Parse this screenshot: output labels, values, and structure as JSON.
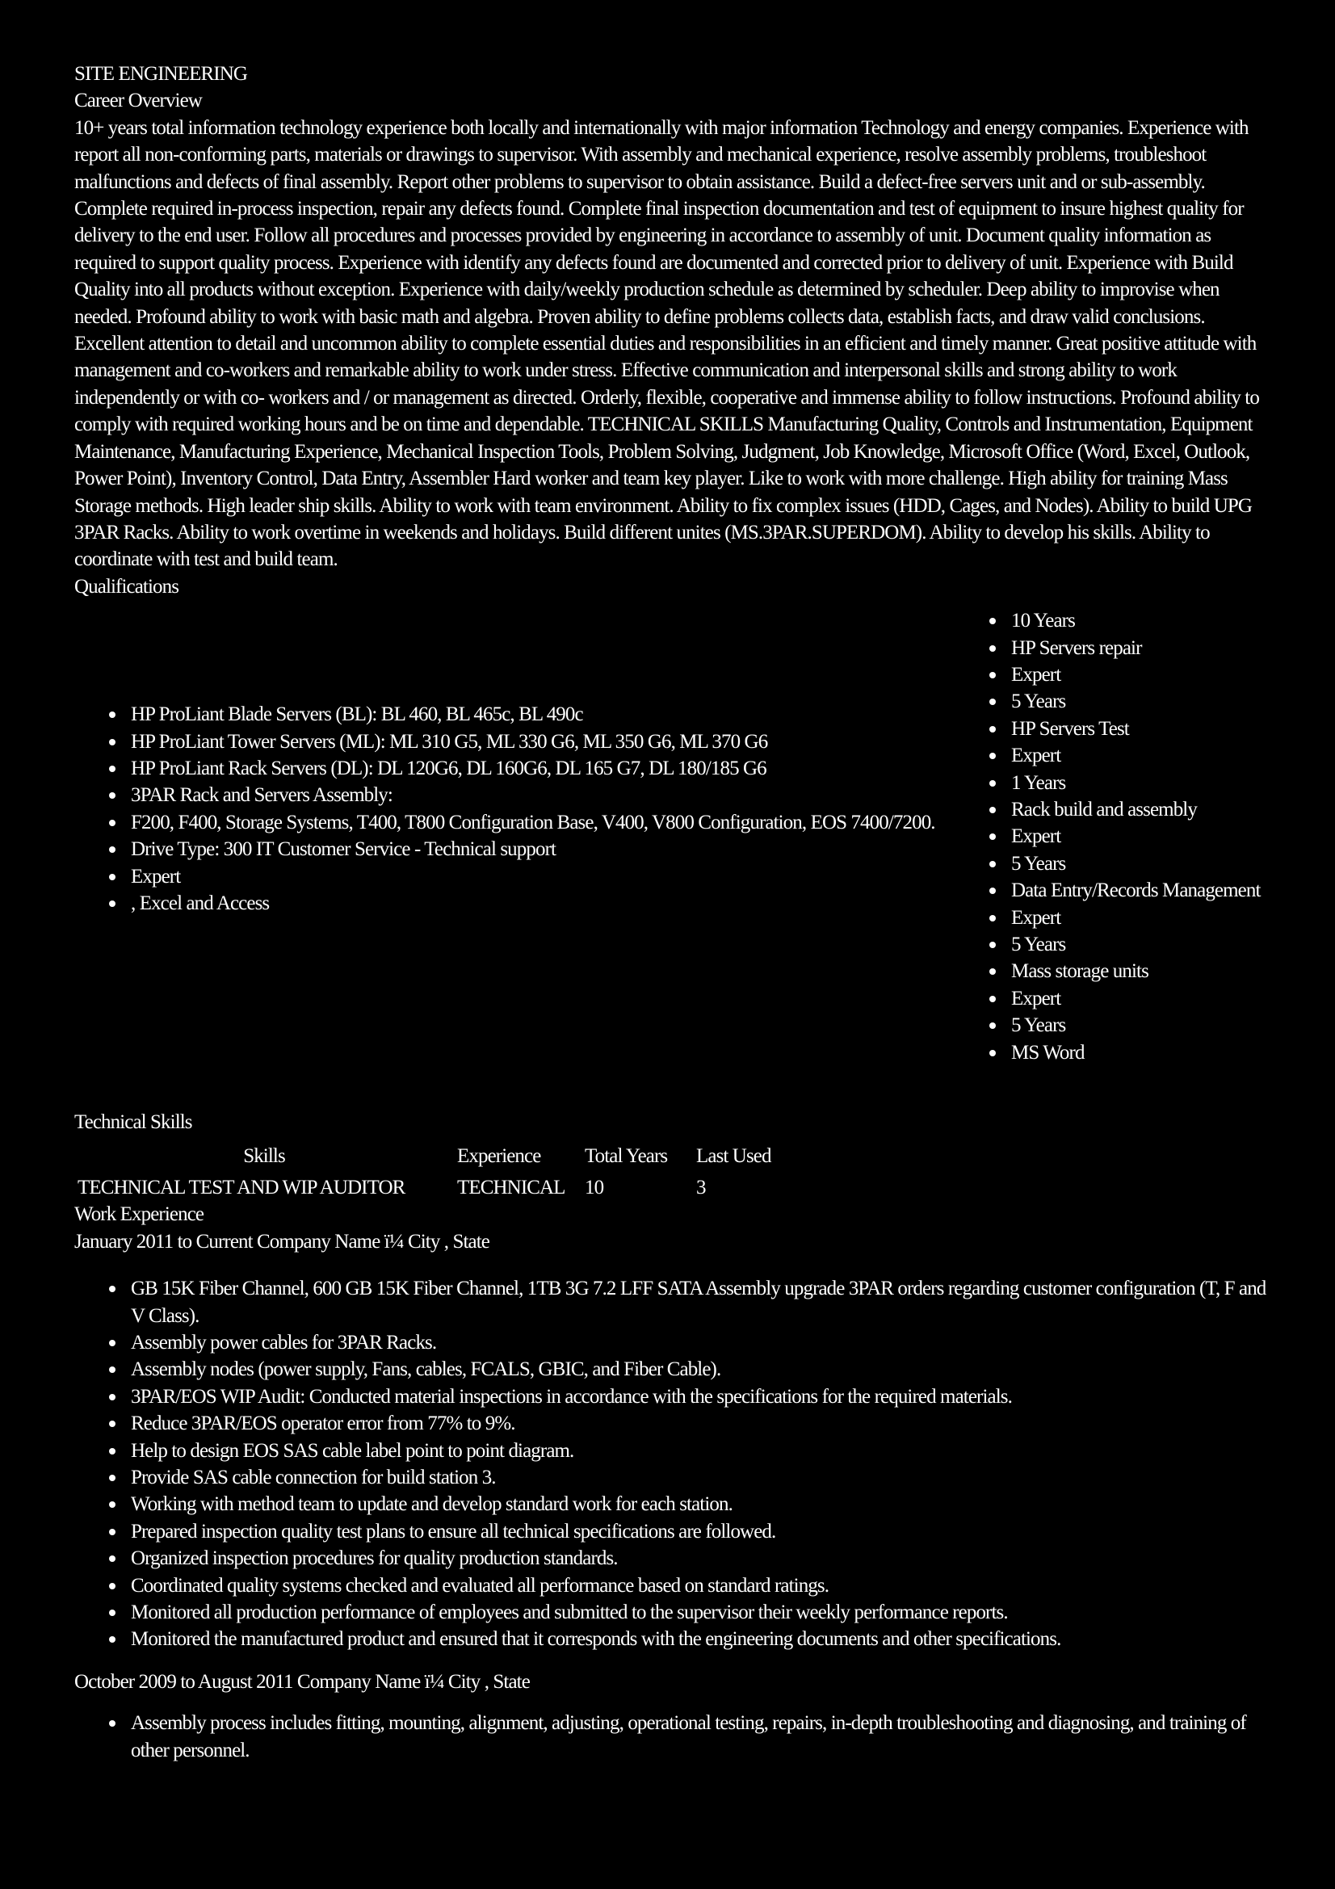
{
  "title": "SITE ENGINEERING",
  "career_overview": {
    "heading": "Career Overview",
    "text": "10+ years total information technology experience both locally and internationally with major information Technology and energy companies. Experience with report all non-conforming parts, materials or drawings to supervisor. With assembly and mechanical experience, resolve assembly problems, troubleshoot malfunctions and defects of final assembly. Report other problems to supervisor to obtain assistance. Build a defect-free servers unit and or sub-assembly. Complete required in-process inspection, repair any defects found. Complete final inspection documentation and test of equipment to insure highest quality for delivery to the end user. Follow all procedures and processes provided by engineering in accordance to assembly of unit. Document quality information as required to support quality process. Experience with identify any defects found are documented and corrected prior to delivery of unit. Experience with Build Quality into all products without exception. Experience with daily/weekly production schedule as determined by scheduler. Deep ability to improvise when needed. Profound ability to work with basic math and algebra. Proven ability to define problems collects data, establish facts, and draw valid conclusions. Excellent attention to detail and uncommon ability to complete essential duties and responsibilities in an efficient and timely manner. Great positive attitude with management and co-workers and remarkable ability to work under stress. Effective communication and interpersonal skills and strong ability to work independently or with co- workers and / or management as directed. Orderly, flexible, cooperative and immense ability to follow instructions. Profound ability to comply with required working hours and be on time and dependable. TECHNICAL SKILLS Manufacturing Quality, Controls and Instrumentation, Equipment Maintenance, Manufacturing Experience, Mechanical Inspection Tools, Problem Solving, Judgment, Job Knowledge, Microsoft Office (Word, Excel, Outlook, Power Point), Inventory Control, Data Entry, Assembler Hard worker and team key player. Like to work with more challenge. High ability for training Mass Storage methods. High leader ship skills. Ability to work with team environment. Ability to fix complex issues (HDD, Cages, and Nodes). Ability to build UPG 3PAR Racks. Ability to work overtime in weekends and holidays. Build different unites (MS.3PAR.SUPERDOM). Ability to develop his skills. Ability to coordinate with test and build team."
  },
  "qualifications": {
    "heading": "Qualifications",
    "left_items": [
      "HP ProLiant Blade Servers (BL): BL 460, BL 465c, BL 490c",
      "HP ProLiant Tower Servers (ML): ML 310 G5, ML 330 G6, ML 350 G6, ML 370 G6",
      "HP ProLiant Rack Servers (DL): DL 120G6, DL 160G6, DL 165 G7, DL 180/185 G6",
      "3PAR Rack and Servers Assembly:",
      "F200, F400, Storage Systems, T400, T800 Configuration Base, V400, V800 Configuration, EOS 7400/7200.",
      "Drive Type: 300 IT Customer Service - Technical support",
      "Expert",
      ", Excel and Access"
    ],
    "right_items": [
      "10 Years",
      "HP Servers repair",
      "Expert",
      "5 Years",
      "HP Servers Test",
      "Expert",
      "1 Years",
      "Rack build and assembly",
      "Expert",
      "5 Years",
      "Data Entry/Records Management",
      "Expert",
      "5 Years",
      "Mass storage units",
      "Expert",
      "5 Years",
      "MS Word"
    ]
  },
  "technical_skills": {
    "heading": "Technical Skills",
    "columns": [
      "Skills",
      "Experience",
      "Total Years",
      "Last Used"
    ],
    "rows": [
      [
        "TECHNICAL TEST AND WIP AUDITOR",
        "TECHNICAL",
        "10",
        "3"
      ]
    ]
  },
  "work_experience": {
    "heading": "Work Experience",
    "jobs": [
      {
        "header": "January 2011 to Current Company Name ï¼ City , State",
        "items": [
          "GB 15K Fiber Channel, 600 GB 15K Fiber Channel, 1TB 3G 7.2 LFF SATA Assembly upgrade 3PAR orders regarding customer configuration (T, F and V Class).",
          "Assembly power cables for 3PAR Racks.",
          "Assembly nodes (power supply, Fans, cables, FCALS, GBIC, and Fiber Cable).",
          "3PAR/EOS WIP Audit: Conducted material inspections in accordance with the specifications for the required materials.",
          "Reduce 3PAR/EOS operator error from 77% to 9%.",
          "Help to design EOS SAS cable label point to point diagram.",
          "Provide SAS cable connection for build station 3.",
          "Working with method team to update and develop standard work for each station.",
          "Prepared inspection quality test plans to ensure all technical specifications are followed.",
          "Organized inspection procedures for quality production standards.",
          "Coordinated quality systems checked and evaluated all performance based on standard ratings.",
          "Monitored all production performance of employees and submitted to the supervisor their weekly performance reports.",
          "Monitored the manufactured product and ensured that it corresponds with the engineering documents and other specifications."
        ]
      },
      {
        "header": "October 2009 to August 2011 Company Name ï¼ City , State",
        "items": [
          "Assembly process includes fitting, mounting, alignment, adjusting, operational testing, repairs, in-depth troubleshooting and diagnosing, and training of other personnel."
        ]
      }
    ]
  }
}
